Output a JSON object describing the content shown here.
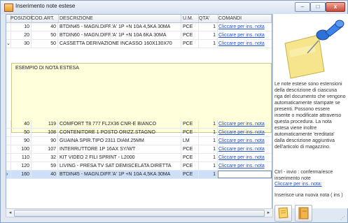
{
  "window": {
    "title": "Inserimento note estese",
    "minimize": "–",
    "maximize": "□",
    "close": "x"
  },
  "grid": {
    "columns": {
      "pos": "POSIZION",
      "cod": "COD.ART.",
      "desc": "DESCRIZIONE",
      "um": "U.M.",
      "qta": "QTA'",
      "cmd": "COMANDI"
    },
    "rows": [
      {
        "ind": "",
        "pos": "10",
        "cod": "40",
        "desc": "BTDIN45 - MAGN.DIFF.'A' 1P +N 10A 4,5KA 30MA",
        "um": "PCE",
        "qta": "1",
        "cmd": "Cliccare per ins. nota"
      },
      {
        "ind": "",
        "pos": "20",
        "cod": "50",
        "desc": "BTDIN60 - MAGN.DIFF.'A' 1P +N 10A 6KA 30MA",
        "um": "PCE",
        "qta": "1",
        "cmd": "Cliccare per ins. nota"
      },
      {
        "ind": "⌄",
        "pos": "30",
        "cod": "50",
        "desc": "CASSETTA DERIVAZIONE INCASSO 160X130X70",
        "um": "PCE",
        "qta": "1",
        "cmd": "Cliccare per ins. nota"
      },
      {
        "ind": "",
        "pos": "40",
        "cod": "119",
        "desc": "COMFORT T8 777 FL2X36 CNR-E BIANCO",
        "um": "PCE",
        "qta": "1",
        "cmd": "Cliccare per ins. nota"
      },
      {
        "ind": "",
        "pos": "50",
        "cod": "108",
        "desc": "CONTENITORE 1 POSTO ORIZZ.STAGNO",
        "um": "PCE",
        "qta": "1",
        "cmd": "Cliccare per ins. nota"
      },
      {
        "ind": "",
        "pos": "90",
        "cod": "90",
        "desc": "GUAINA SPIR.TIPO 2311 DIAM.25MM",
        "um": "LM",
        "qta": "1",
        "cmd": "Cliccare per ins. nota"
      },
      {
        "ind": "",
        "pos": "100",
        "cod": "107",
        "desc": "INTERRUTTORE 1P 16AX SY/WT",
        "um": "PCE",
        "qta": "1",
        "cmd": "Cliccare per ins. nota"
      },
      {
        "ind": "",
        "pos": "110",
        "cod": "32",
        "desc": "KIT VIDEO 2 FILI SPRINT - L2000",
        "um": "PCE",
        "qta": "1",
        "cmd": "Cliccare per ins. nota"
      },
      {
        "ind": "",
        "pos": "120",
        "cod": "59",
        "desc": "LIVING - PRESA TV SAT DEMISCELATA DIRETTA",
        "um": "PCE",
        "qta": "1",
        "cmd": "Cliccare per ins. nota"
      },
      {
        "ind": "›",
        "pos": "160",
        "cod": "40",
        "desc": "BTDIN45 - MAGN.DIFF.'A' 1P +N 10A 4,5KA 30MA",
        "um": "PCE",
        "qta": "1",
        "cmd": ""
      }
    ],
    "note_text": "ESEMPIO DI NOTA ESTESA"
  },
  "panel": {
    "help_text": "Le note estese sono estensioni della descrizione di ciascuna riga del documento che vengono automaticamente stampate se presenti. Possono essere inserite o modificate attraverso questa procedura. La nota estesa viene inoltre automaticamente 'ereditata' dalla descrizione aggiuntiva dell'articolo di magazzino.",
    "ctrl_help": "Ctrl - invio : conferma/esce inserimento note",
    "link": "Cliccare per ins. nota:",
    "insert_label": "Inserisce una nuova nota ( ins )",
    "icons": [
      "pushpin-note-icon",
      "add-note-icon",
      "book-icon"
    ]
  },
  "colors": {
    "note_bg": "#ffffdc",
    "link": "#1f4fd1",
    "selected_row": "#cde0f7"
  }
}
